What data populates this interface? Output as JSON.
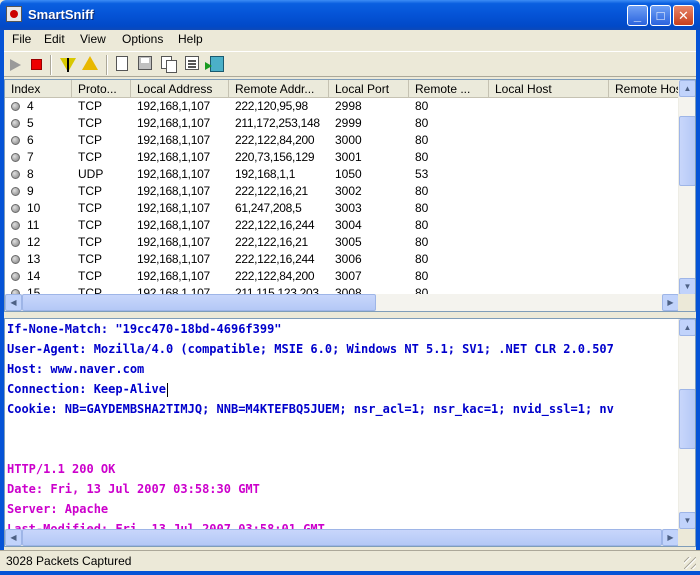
{
  "window": {
    "title": "SmartSniff"
  },
  "menu": [
    "File",
    "Edit",
    "View",
    "Options",
    "Help"
  ],
  "toolbar": {
    "icons": [
      "play-icon",
      "stop-icon",
      "filter-icon",
      "filter-alt-icon",
      "new-document-icon",
      "save-icon",
      "copy-icon",
      "properties-icon",
      "exit-icon"
    ]
  },
  "packet_list": {
    "columns": [
      "Index",
      "Proto...",
      "Local Address",
      "Remote Addr...",
      "Local Port",
      "Remote ...",
      "Local Host",
      "Remote Hos"
    ],
    "rows": [
      [
        "4",
        "TCP",
        "192,168,1,107",
        "222,120,95,98",
        "2998",
        "80"
      ],
      [
        "5",
        "TCP",
        "192,168,1,107",
        "211,172,253,148",
        "2999",
        "80"
      ],
      [
        "6",
        "TCP",
        "192,168,1,107",
        "222,122,84,200",
        "3000",
        "80"
      ],
      [
        "7",
        "TCP",
        "192,168,1,107",
        "220,73,156,129",
        "3001",
        "80"
      ],
      [
        "8",
        "UDP",
        "192,168,1,107",
        "192,168,1,1",
        "1050",
        "53"
      ],
      [
        "9",
        "TCP",
        "192,168,1,107",
        "222,122,16,21",
        "3002",
        "80"
      ],
      [
        "10",
        "TCP",
        "192,168,1,107",
        "61,247,208,5",
        "3003",
        "80"
      ],
      [
        "11",
        "TCP",
        "192,168,1,107",
        "222,122,16,244",
        "3004",
        "80"
      ],
      [
        "12",
        "TCP",
        "192,168,1,107",
        "222,122,16,21",
        "3005",
        "80"
      ],
      [
        "13",
        "TCP",
        "192,168,1,107",
        "222,122,16,244",
        "3006",
        "80"
      ],
      [
        "14",
        "TCP",
        "192,168,1,107",
        "222,122,84,200",
        "3007",
        "80"
      ],
      [
        "15",
        "TCP",
        "192,168,1,107",
        "211,115,123,203",
        "3008",
        "80"
      ]
    ]
  },
  "detail": {
    "lines": [
      {
        "text": "If-None-Match: \"19cc470-18bd-4696f399\"",
        "kind": "req"
      },
      {
        "text": "User-Agent: Mozilla/4.0 (compatible; MSIE 6.0; Windows NT 5.1; SV1; .NET CLR 2.0.507",
        "kind": "req"
      },
      {
        "text": "Host: www.naver.com",
        "kind": "req"
      },
      {
        "text": "Connection: Keep-Alive",
        "kind": "req"
      },
      {
        "text": "Cookie: NB=GAYDEMBSHA2TIMJQ; NNB=M4KTEFBQ5JUEM; nsr_acl=1; nsr_kac=1; nvid_ssl=1; nv",
        "kind": "req"
      },
      {
        "text": "",
        "kind": "req"
      },
      {
        "text": "",
        "kind": "req"
      },
      {
        "text": "HTTP/1.1 200 OK",
        "kind": "resp"
      },
      {
        "text": "Date: Fri, 13 Jul 2007 03:58:30 GMT",
        "kind": "resp"
      },
      {
        "text": "Server: Apache",
        "kind": "resp"
      },
      {
        "text": "Last-Modified: Fri, 13 Jul 2007 03:58:01 GMT",
        "kind": "resp"
      }
    ]
  },
  "status": {
    "text": "3028 Packets Captured"
  }
}
